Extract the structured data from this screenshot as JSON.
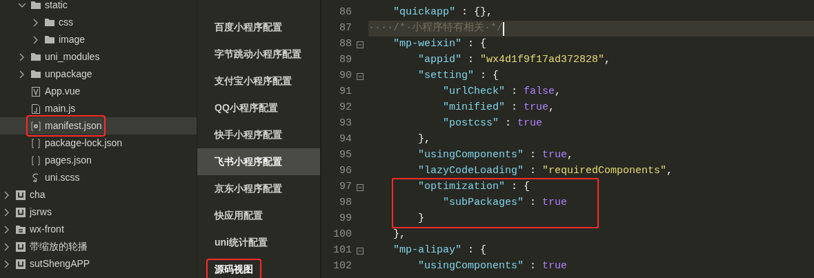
{
  "file_tree": {
    "items": [
      {
        "name": "static",
        "kind": "folder",
        "expanded": true,
        "selected": false,
        "highlighted": false,
        "children": [
          {
            "name": "css",
            "kind": "folder",
            "expanded": false,
            "selected": false,
            "highlighted": false
          },
          {
            "name": "image",
            "kind": "folder",
            "expanded": false,
            "selected": false,
            "highlighted": false
          }
        ]
      },
      {
        "name": "uni_modules",
        "kind": "folder",
        "expanded": false,
        "selected": false,
        "highlighted": false
      },
      {
        "name": "unpackage",
        "kind": "folder",
        "expanded": false,
        "selected": false,
        "highlighted": false
      },
      {
        "name": "App.vue",
        "kind": "vue",
        "selected": false,
        "highlighted": false
      },
      {
        "name": "main.js",
        "kind": "js",
        "selected": false,
        "highlighted": false
      },
      {
        "name": "manifest.json",
        "kind": "config",
        "selected": true,
        "highlighted": true
      },
      {
        "name": "package-lock.json",
        "kind": "brackets",
        "selected": false,
        "highlighted": false
      },
      {
        "name": "pages.json",
        "kind": "brackets",
        "selected": false,
        "highlighted": false
      },
      {
        "name": "uni.scss",
        "kind": "sass",
        "selected": false,
        "highlighted": false
      }
    ],
    "projects": [
      {
        "name": "cha",
        "kind": "project",
        "expanded": false,
        "selected": false,
        "highlighted": false
      },
      {
        "name": "jsrws",
        "kind": "project",
        "expanded": false,
        "selected": false,
        "highlighted": false
      },
      {
        "name": "wx-front",
        "kind": "folder-doc",
        "expanded": false,
        "selected": false,
        "highlighted": false
      },
      {
        "name": "带缩放的轮播",
        "kind": "project",
        "expanded": false,
        "selected": false,
        "highlighted": false
      },
      {
        "name": "sutShengAPP",
        "kind": "project",
        "expanded": false,
        "selected": false,
        "highlighted": false
      }
    ]
  },
  "config_nav": {
    "items": [
      {
        "label": "百度小程序配置",
        "hovered": false,
        "selected": false,
        "highlighted": false
      },
      {
        "label": "字节跳动小程序配置",
        "hovered": false,
        "selected": false,
        "highlighted": false
      },
      {
        "label": "支付宝小程序配置",
        "hovered": false,
        "selected": false,
        "highlighted": false
      },
      {
        "label": "QQ小程序配置",
        "hovered": false,
        "selected": false,
        "highlighted": false
      },
      {
        "label": "快手小程序配置",
        "hovered": false,
        "selected": false,
        "highlighted": false
      },
      {
        "label": "飞书小程序配置",
        "hovered": true,
        "selected": false,
        "highlighted": false
      },
      {
        "label": "京东小程序配置",
        "hovered": false,
        "selected": false,
        "highlighted": false
      },
      {
        "label": "快应用配置",
        "hovered": false,
        "selected": false,
        "highlighted": false
      },
      {
        "label": "uni统计配置",
        "hovered": false,
        "selected": false,
        "highlighted": false
      },
      {
        "label": "源码视图",
        "hovered": false,
        "selected": true,
        "highlighted": true
      }
    ]
  },
  "editor": {
    "lines": [
      {
        "number": "86",
        "fold": false,
        "current": false,
        "boxed": false,
        "tokens": [
          {
            "kind": "key",
            "text": "    \"quickapp\""
          },
          {
            "kind": "punct",
            "text": " : {},"
          }
        ]
      },
      {
        "number": "87",
        "fold": false,
        "current": true,
        "boxed": false,
        "tokens": [
          {
            "kind": "comment",
            "text": "····/*·小程序特有相关·*/"
          }
        ]
      },
      {
        "number": "88",
        "fold": true,
        "current": false,
        "boxed": false,
        "tokens": [
          {
            "kind": "key",
            "text": "    \"mp-weixin\""
          },
          {
            "kind": "punct",
            "text": " : {"
          }
        ]
      },
      {
        "number": "89",
        "fold": false,
        "current": false,
        "boxed": false,
        "tokens": [
          {
            "kind": "key",
            "text": "        \"appid\""
          },
          {
            "kind": "punct",
            "text": " : "
          },
          {
            "kind": "string",
            "text": "\"wx4d1f9f17ad372828\""
          },
          {
            "kind": "punct",
            "text": ","
          }
        ]
      },
      {
        "number": "90",
        "fold": true,
        "current": false,
        "boxed": false,
        "tokens": [
          {
            "kind": "key",
            "text": "        \"setting\""
          },
          {
            "kind": "punct",
            "text": " : {"
          }
        ]
      },
      {
        "number": "91",
        "fold": false,
        "current": false,
        "boxed": false,
        "tokens": [
          {
            "kind": "key",
            "text": "            \"urlCheck\""
          },
          {
            "kind": "punct",
            "text": " : "
          },
          {
            "kind": "bool",
            "text": "false"
          },
          {
            "kind": "punct",
            "text": ","
          }
        ]
      },
      {
        "number": "92",
        "fold": false,
        "current": false,
        "boxed": false,
        "tokens": [
          {
            "kind": "key",
            "text": "            \"minified\""
          },
          {
            "kind": "punct",
            "text": " : "
          },
          {
            "kind": "bool",
            "text": "true"
          },
          {
            "kind": "punct",
            "text": ","
          }
        ]
      },
      {
        "number": "93",
        "fold": false,
        "current": false,
        "boxed": false,
        "tokens": [
          {
            "kind": "key",
            "text": "            \"postcss\""
          },
          {
            "kind": "punct",
            "text": " : "
          },
          {
            "kind": "bool",
            "text": "true"
          }
        ]
      },
      {
        "number": "94",
        "fold": false,
        "current": false,
        "boxed": false,
        "tokens": [
          {
            "kind": "punct",
            "text": "        },"
          }
        ]
      },
      {
        "number": "95",
        "fold": false,
        "current": false,
        "boxed": false,
        "tokens": [
          {
            "kind": "key",
            "text": "        \"usingComponents\""
          },
          {
            "kind": "punct",
            "text": " : "
          },
          {
            "kind": "bool",
            "text": "true"
          },
          {
            "kind": "punct",
            "text": ","
          }
        ]
      },
      {
        "number": "96",
        "fold": false,
        "current": false,
        "boxed": false,
        "tokens": [
          {
            "kind": "key",
            "text": "        \"lazyCodeLoading\""
          },
          {
            "kind": "punct",
            "text": " : "
          },
          {
            "kind": "string",
            "text": "\"requiredComponents\""
          },
          {
            "kind": "punct",
            "text": ","
          }
        ]
      },
      {
        "number": "97",
        "fold": true,
        "current": false,
        "boxed": true,
        "tokens": [
          {
            "kind": "key",
            "text": "        \"optimization\""
          },
          {
            "kind": "punct",
            "text": " : {"
          }
        ]
      },
      {
        "number": "98",
        "fold": false,
        "current": false,
        "boxed": true,
        "tokens": [
          {
            "kind": "key",
            "text": "            \"subPackages\""
          },
          {
            "kind": "punct",
            "text": " : "
          },
          {
            "kind": "bool",
            "text": "true"
          }
        ]
      },
      {
        "number": "99",
        "fold": false,
        "current": false,
        "boxed": true,
        "tokens": [
          {
            "kind": "punct",
            "text": "        }"
          }
        ]
      },
      {
        "number": "100",
        "fold": false,
        "current": false,
        "boxed": false,
        "tokens": [
          {
            "kind": "punct",
            "text": "    },"
          }
        ]
      },
      {
        "number": "101",
        "fold": true,
        "current": false,
        "boxed": false,
        "tokens": [
          {
            "kind": "key",
            "text": "    \"mp-alipay\""
          },
          {
            "kind": "punct",
            "text": " : {"
          }
        ]
      },
      {
        "number": "102",
        "fold": false,
        "current": false,
        "boxed": false,
        "tokens": [
          {
            "kind": "key",
            "text": "        \"usingComponents\""
          },
          {
            "kind": "punct",
            "text": " : "
          },
          {
            "kind": "bool",
            "text": "true"
          }
        ]
      }
    ]
  }
}
